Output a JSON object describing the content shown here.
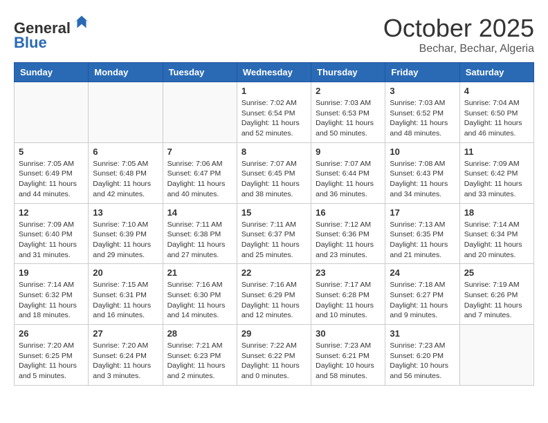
{
  "header": {
    "logo": {
      "line1": "General",
      "line2": "Blue"
    },
    "month": "October 2025",
    "location": "Bechar, Bechar, Algeria"
  },
  "weekdays": [
    "Sunday",
    "Monday",
    "Tuesday",
    "Wednesday",
    "Thursday",
    "Friday",
    "Saturday"
  ],
  "weeks": [
    [
      {
        "day": "",
        "info": ""
      },
      {
        "day": "",
        "info": ""
      },
      {
        "day": "",
        "info": ""
      },
      {
        "day": "1",
        "info": "Sunrise: 7:02 AM\nSunset: 6:54 PM\nDaylight: 11 hours\nand 52 minutes."
      },
      {
        "day": "2",
        "info": "Sunrise: 7:03 AM\nSunset: 6:53 PM\nDaylight: 11 hours\nand 50 minutes."
      },
      {
        "day": "3",
        "info": "Sunrise: 7:03 AM\nSunset: 6:52 PM\nDaylight: 11 hours\nand 48 minutes."
      },
      {
        "day": "4",
        "info": "Sunrise: 7:04 AM\nSunset: 6:50 PM\nDaylight: 11 hours\nand 46 minutes."
      }
    ],
    [
      {
        "day": "5",
        "info": "Sunrise: 7:05 AM\nSunset: 6:49 PM\nDaylight: 11 hours\nand 44 minutes."
      },
      {
        "day": "6",
        "info": "Sunrise: 7:05 AM\nSunset: 6:48 PM\nDaylight: 11 hours\nand 42 minutes."
      },
      {
        "day": "7",
        "info": "Sunrise: 7:06 AM\nSunset: 6:47 PM\nDaylight: 11 hours\nand 40 minutes."
      },
      {
        "day": "8",
        "info": "Sunrise: 7:07 AM\nSunset: 6:45 PM\nDaylight: 11 hours\nand 38 minutes."
      },
      {
        "day": "9",
        "info": "Sunrise: 7:07 AM\nSunset: 6:44 PM\nDaylight: 11 hours\nand 36 minutes."
      },
      {
        "day": "10",
        "info": "Sunrise: 7:08 AM\nSunset: 6:43 PM\nDaylight: 11 hours\nand 34 minutes."
      },
      {
        "day": "11",
        "info": "Sunrise: 7:09 AM\nSunset: 6:42 PM\nDaylight: 11 hours\nand 33 minutes."
      }
    ],
    [
      {
        "day": "12",
        "info": "Sunrise: 7:09 AM\nSunset: 6:40 PM\nDaylight: 11 hours\nand 31 minutes."
      },
      {
        "day": "13",
        "info": "Sunrise: 7:10 AM\nSunset: 6:39 PM\nDaylight: 11 hours\nand 29 minutes."
      },
      {
        "day": "14",
        "info": "Sunrise: 7:11 AM\nSunset: 6:38 PM\nDaylight: 11 hours\nand 27 minutes."
      },
      {
        "day": "15",
        "info": "Sunrise: 7:11 AM\nSunset: 6:37 PM\nDaylight: 11 hours\nand 25 minutes."
      },
      {
        "day": "16",
        "info": "Sunrise: 7:12 AM\nSunset: 6:36 PM\nDaylight: 11 hours\nand 23 minutes."
      },
      {
        "day": "17",
        "info": "Sunrise: 7:13 AM\nSunset: 6:35 PM\nDaylight: 11 hours\nand 21 minutes."
      },
      {
        "day": "18",
        "info": "Sunrise: 7:14 AM\nSunset: 6:34 PM\nDaylight: 11 hours\nand 20 minutes."
      }
    ],
    [
      {
        "day": "19",
        "info": "Sunrise: 7:14 AM\nSunset: 6:32 PM\nDaylight: 11 hours\nand 18 minutes."
      },
      {
        "day": "20",
        "info": "Sunrise: 7:15 AM\nSunset: 6:31 PM\nDaylight: 11 hours\nand 16 minutes."
      },
      {
        "day": "21",
        "info": "Sunrise: 7:16 AM\nSunset: 6:30 PM\nDaylight: 11 hours\nand 14 minutes."
      },
      {
        "day": "22",
        "info": "Sunrise: 7:16 AM\nSunset: 6:29 PM\nDaylight: 11 hours\nand 12 minutes."
      },
      {
        "day": "23",
        "info": "Sunrise: 7:17 AM\nSunset: 6:28 PM\nDaylight: 11 hours\nand 10 minutes."
      },
      {
        "day": "24",
        "info": "Sunrise: 7:18 AM\nSunset: 6:27 PM\nDaylight: 11 hours\nand 9 minutes."
      },
      {
        "day": "25",
        "info": "Sunrise: 7:19 AM\nSunset: 6:26 PM\nDaylight: 11 hours\nand 7 minutes."
      }
    ],
    [
      {
        "day": "26",
        "info": "Sunrise: 7:20 AM\nSunset: 6:25 PM\nDaylight: 11 hours\nand 5 minutes."
      },
      {
        "day": "27",
        "info": "Sunrise: 7:20 AM\nSunset: 6:24 PM\nDaylight: 11 hours\nand 3 minutes."
      },
      {
        "day": "28",
        "info": "Sunrise: 7:21 AM\nSunset: 6:23 PM\nDaylight: 11 hours\nand 2 minutes."
      },
      {
        "day": "29",
        "info": "Sunrise: 7:22 AM\nSunset: 6:22 PM\nDaylight: 11 hours\nand 0 minutes."
      },
      {
        "day": "30",
        "info": "Sunrise: 7:23 AM\nSunset: 6:21 PM\nDaylight: 10 hours\nand 58 minutes."
      },
      {
        "day": "31",
        "info": "Sunrise: 7:23 AM\nSunset: 6:20 PM\nDaylight: 10 hours\nand 56 minutes."
      },
      {
        "day": "",
        "info": ""
      }
    ]
  ]
}
